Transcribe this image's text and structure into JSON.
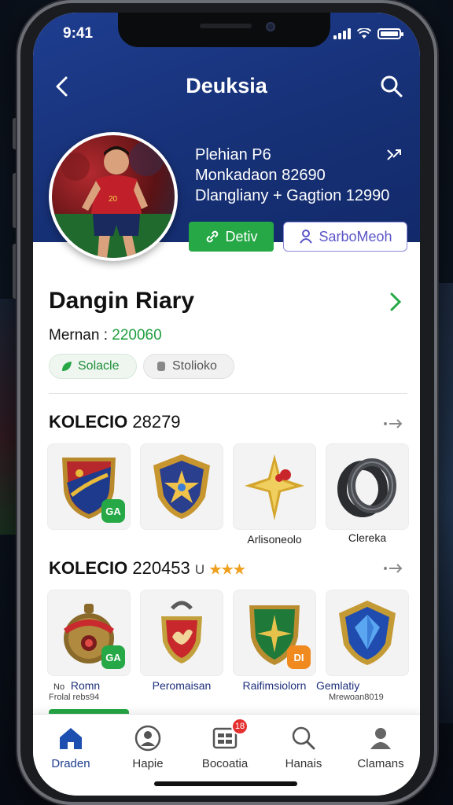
{
  "status": {
    "time": "9:41"
  },
  "header": {
    "title": "Deuksia"
  },
  "profile": {
    "line1": "Plehian P6",
    "line2": "Monkadaon 82690",
    "line3": "Dlangliany + Gagtion 12990",
    "follow_label": "Detiv",
    "subscribe_label": "SarboMeoh"
  },
  "player": {
    "name": "Dangin Riary",
    "member_label": "Mernan :",
    "member_value": "220060",
    "chip1": "Solacle",
    "chip2": "Stolioko"
  },
  "section1": {
    "title": "KOLECIO",
    "count": "28279",
    "items": [
      {
        "name": "shield",
        "badge": "GA",
        "badge_color": "#25a845",
        "label": ""
      },
      {
        "name": "star-shield",
        "badge": "",
        "label": ""
      },
      {
        "name": "gold-star",
        "badge": "",
        "label": "Arlisoneolo"
      },
      {
        "name": "ring",
        "badge": "",
        "label": "Clereka"
      }
    ]
  },
  "section2": {
    "title": "KOLECIO",
    "count": "220453",
    "suffix": "U",
    "stars": "★★★",
    "items": [
      {
        "name": "red-orb",
        "badge": "GA",
        "badge_color": "#25a845",
        "label": "Romn",
        "prefix": "No",
        "sub": "Frolal rebs94"
      },
      {
        "name": "red-crest",
        "badge": "",
        "label": "Peromaisan",
        "sub": ""
      },
      {
        "name": "green-shield",
        "badge": "DI",
        "badge_color": "#f08a1e",
        "label": "Raifimsiolorn",
        "sub": ""
      },
      {
        "name": "blue-gem",
        "badge": "",
        "label": "Gemlatiy",
        "sub": "Mrewoan8019"
      }
    ]
  },
  "tabs": [
    {
      "label": "Draden",
      "icon": "home-icon",
      "active": true
    },
    {
      "label": "Hapie",
      "icon": "profile-circle-icon",
      "active": false
    },
    {
      "label": "Bocoatia",
      "icon": "grid-card-icon",
      "active": false,
      "badge": "18"
    },
    {
      "label": "Hanais",
      "icon": "search-icon",
      "active": false
    },
    {
      "label": "Clamans",
      "icon": "person-icon",
      "active": false
    }
  ],
  "colors": {
    "primary": "#1c3c8e",
    "green": "#25a845",
    "purple": "#5b55c7"
  }
}
